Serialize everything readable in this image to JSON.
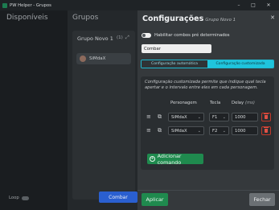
{
  "window": {
    "title": "PW Helper - Grupos",
    "controls": {
      "minimize": "–",
      "maximize": "□",
      "close": "✕"
    }
  },
  "columns": {
    "disponiveis_header": "Disponíveis",
    "grupos_header": "Grupos"
  },
  "group_card": {
    "name": "Grupo Novo 1",
    "count": "(1)",
    "expand_icon": "expand-icon",
    "member": "SiMdaX",
    "loop_label": "Loop",
    "combat_button": "Combar"
  },
  "panel": {
    "title": "Configurações",
    "subtitle": "Grupo Novo 1",
    "close": "✕",
    "checkbox_label": "Habilitar combos pré determinados",
    "input_value": "Combar",
    "tabs": [
      {
        "label": "Configuração automática",
        "active": false
      },
      {
        "label": "Configuração customizada",
        "active": true
      }
    ],
    "description": "Configuração customizada permite que indique qual tecla apertar e o intervalo entre eles em cada personagem.",
    "headers": {
      "character": "Personagem",
      "key": "Tecla",
      "delay": "Delay",
      "delay_unit": "(ms)"
    },
    "rows": [
      {
        "character": "SiMdaX",
        "key": "F1",
        "delay": "1000"
      },
      {
        "character": "SiMdaX",
        "key": "F2",
        "delay": "1000"
      }
    ],
    "add_button": "Adicionar comando",
    "apply_button": "Aplicar",
    "close_button": "Fechar"
  },
  "colors": {
    "accent_cyan": "#1fc4dc",
    "success_green": "#1f8a4e",
    "danger_red": "#e05246",
    "primary_blue": "#2a5fd0"
  }
}
